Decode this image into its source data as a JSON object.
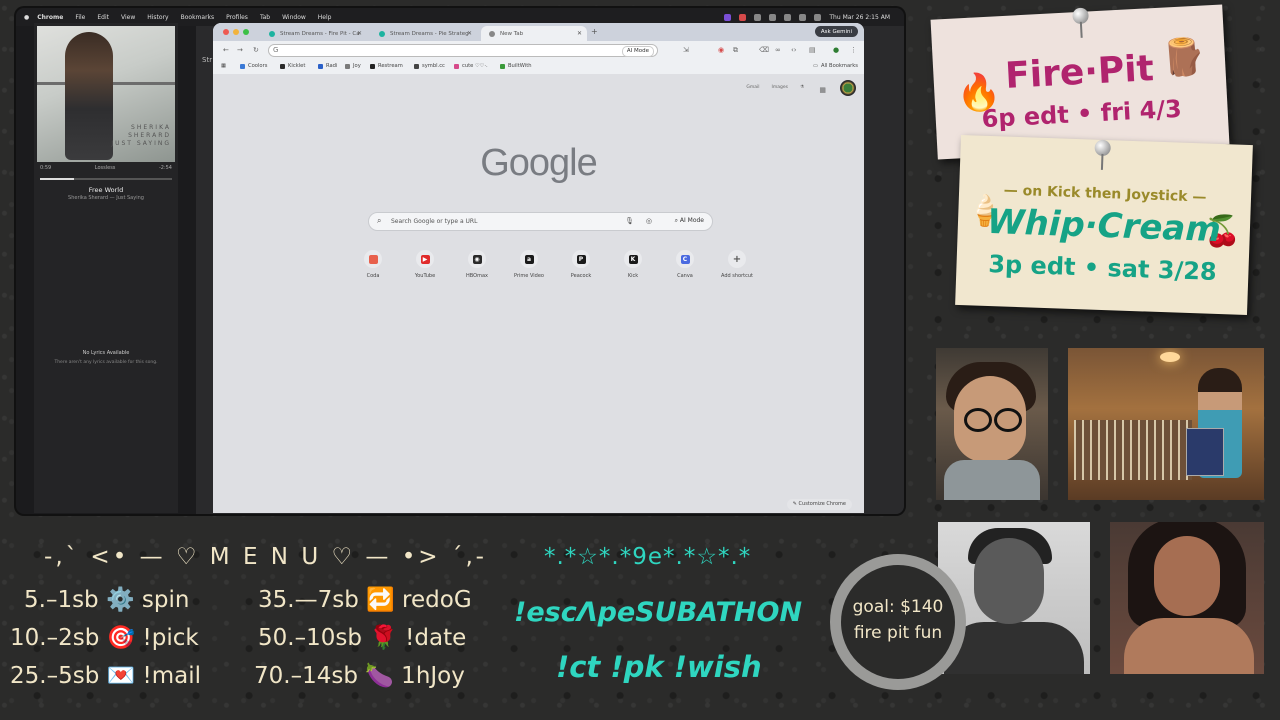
{
  "menubar": {
    "app": "Chrome",
    "items": [
      "File",
      "Edit",
      "View",
      "History",
      "Bookmarks",
      "Profiles",
      "Tab",
      "Window",
      "Help"
    ],
    "clock": "Thu Mar 26  2:15 AM"
  },
  "music": {
    "cover_text": "SHERIKA SHERARD JUST SAYING",
    "elapsed": "0:59",
    "quality": "Lossless",
    "remaining": "-2:54",
    "progress": 0.26,
    "song": "Free World",
    "artist": "Sherika Sherard — Just Saying",
    "no_lyrics_title": "No Lyrics Available",
    "no_lyrics_sub": "There aren't any lyrics available for this song."
  },
  "bg_window": {
    "label": "Str"
  },
  "chrome": {
    "tabs": [
      {
        "label": "Stream Dreams - Fire Pit - Ca"
      },
      {
        "label": "Stream Dreams - Pie Strateg"
      },
      {
        "label": "New Tab"
      }
    ],
    "ask_gemini": "Ask Gemini",
    "omni_ai_mode": "AI Mode",
    "bookmarks": [
      {
        "label": "Coolors",
        "color": "#3a79d6"
      },
      {
        "label": "Kicklet",
        "color": "#2a2a2a"
      },
      {
        "label": "Radi",
        "color": "#2a60c8"
      },
      {
        "label": "Joy",
        "color": "#7a7a7a"
      },
      {
        "label": "Restream",
        "color": "#222222"
      },
      {
        "label": "symbl.cc",
        "color": "#444444"
      },
      {
        "label": "cute ♡♡·.",
        "color": "#d64a8a"
      },
      {
        "label": "BuiltWith",
        "color": "#3a9a3a"
      }
    ],
    "all_bookmarks": "All Bookmarks",
    "top_links": [
      "Gmail",
      "Images"
    ],
    "logo": "Google",
    "search_placeholder": "Search Google or type a URL",
    "search_ai_mode": "AI Mode",
    "shortcuts": [
      {
        "label": "Coda",
        "color": "#e8604c",
        "glyph": ""
      },
      {
        "label": "YouTube",
        "color": "#e02b2b",
        "glyph": "▶"
      },
      {
        "label": "HBOmax",
        "color": "#2a2a2a",
        "glyph": "◉"
      },
      {
        "label": "Prime Video",
        "color": "#1a1a1a",
        "glyph": "a"
      },
      {
        "label": "Peacock",
        "color": "#1a1a1a",
        "glyph": "P"
      },
      {
        "label": "Kick",
        "color": "#1a1a1a",
        "glyph": "K"
      },
      {
        "label": "Canva",
        "color": "#4a6ae0",
        "glyph": "C"
      },
      {
        "label": "Add shortcut",
        "color": "#e9eaed",
        "glyph": "+"
      }
    ],
    "customize": "Customize Chrome"
  },
  "firepit": {
    "title": "Fire·Pit",
    "date": "6p edt • fri 4/3",
    "emoji_left": "🔥",
    "emoji_right": "🪵"
  },
  "whipcream": {
    "top": "— on Kick then Joystick —",
    "title": "Whip·Cream",
    "date": "3p edt • sat 3/28",
    "emoji_left": "🍦",
    "emoji_right": "🍒"
  },
  "menu": {
    "title": "-‚` <• — ♡ M E N U ♡ — •> ´‚-",
    "rows": [
      "5.–1sb ⚙️ spin",
      "10.–2sb 🎯 !pick",
      "25.–5sb 💌 !mail",
      "35.—7sb 🔁 redoG",
      "50.–10sb 🌹 !date",
      "70.–14sb 🍆 1hJoy"
    ]
  },
  "subathon": {
    "line1": "*.*☆*.*9e*.*☆*.*",
    "line2": "!escΛpeSUBATHON",
    "line3": "!ct !pk !wish"
  },
  "goal": {
    "line1": "goal: $140",
    "line2": "fire pit fun"
  }
}
